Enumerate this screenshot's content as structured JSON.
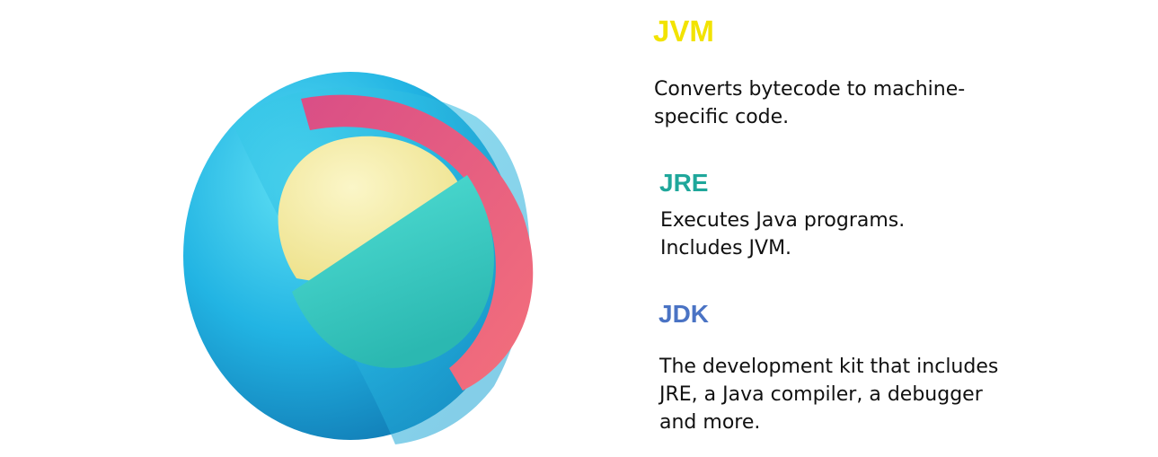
{
  "items": [
    {
      "title": "JVM",
      "lines": [
        "Converts bytecode to machine-",
        "specific code."
      ]
    },
    {
      "title": "JRE",
      "lines": [
        "Executes Java programs.",
        "Includes JVM."
      ]
    },
    {
      "title": "JDK",
      "lines": [
        "The development kit that includes",
        "JRE, a Java compiler, a debugger",
        "and more."
      ]
    }
  ],
  "colors": {
    "jvm": "#f2e300",
    "jre": "#1fa79b",
    "jdk": "#4a73c4",
    "outer_sphere": "#22b4e3",
    "middle_shell": "#e8557a",
    "inner_core_top": "#f2ec9e",
    "inner_core_bottom": "#3fd0c6"
  }
}
